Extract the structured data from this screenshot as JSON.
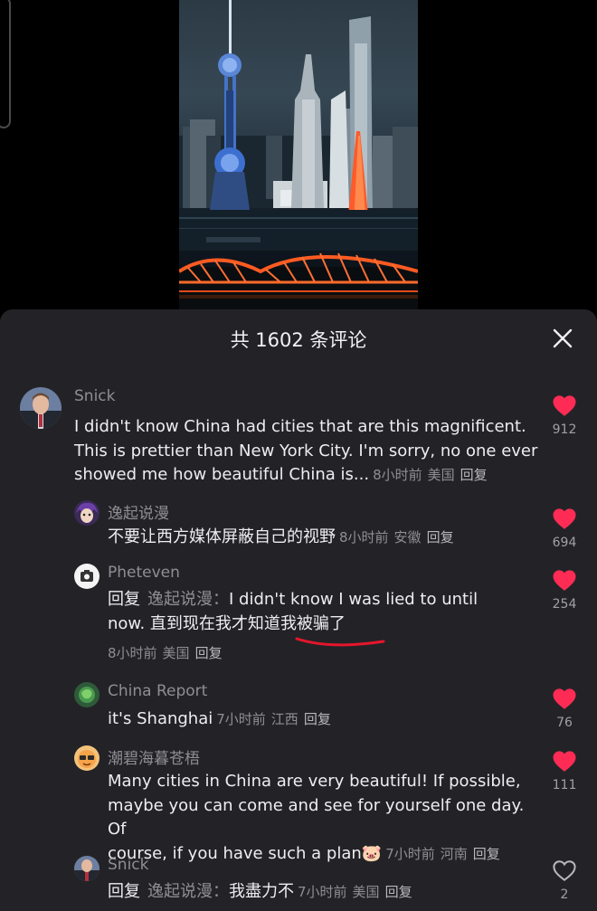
{
  "sheet": {
    "title": "共 1602 条评论",
    "close_icon": "close-icon"
  },
  "colors": {
    "sheet_bg": "#232327",
    "like_active": "#fe2c55",
    "underline": "#e5162c"
  },
  "comments": [
    {
      "username": "Snick",
      "text_lines": [
        "I didn't know China had cities that are this magnificent.",
        "This is prettier than New York City. I'm sorry, no one ever",
        "showed me how beautiful China is..."
      ],
      "time": "8小时前",
      "location": "美国",
      "reply_label": "回复",
      "likes": "912",
      "liked": true
    },
    {
      "username": "逸起说漫",
      "text": "不要让西方媒体屏蔽自己的视野",
      "time": "8小时前",
      "location": "安徽",
      "reply_label": "回复",
      "likes": "694",
      "liked": true
    },
    {
      "username": "Pheteven",
      "reply_prefix": "回复",
      "reply_target": "逸起说漫：",
      "text_line1": "I didn't know I was lied to until",
      "text_line2a": "now. 直到现在我才知道",
      "text_line2b": "我被骗了",
      "time": "8小时前",
      "location": "美国",
      "reply_label": "回复",
      "likes": "254",
      "liked": true
    },
    {
      "username": "China Report",
      "text": "it's Shanghai",
      "time": "7小时前",
      "location": "江西",
      "reply_label": "回复",
      "likes": "76",
      "liked": true
    },
    {
      "username": "潮碧海暮苍梧",
      "text_lines": [
        "Many cities in China are very beautiful! If possible,",
        "maybe you can come and see for yourself one day. Of",
        "course, if you have such a plan"
      ],
      "emoji": "🐷",
      "time": "7小时前",
      "location": "河南",
      "reply_label": "回复",
      "likes": "111",
      "liked": true
    },
    {
      "username": "Snick",
      "reply_prefix": "回复",
      "reply_target": "逸起说漫：",
      "text": "我盡力不",
      "time": "7小时前",
      "location": "美国",
      "reply_label": "回复",
      "likes": "2",
      "liked": false
    }
  ]
}
